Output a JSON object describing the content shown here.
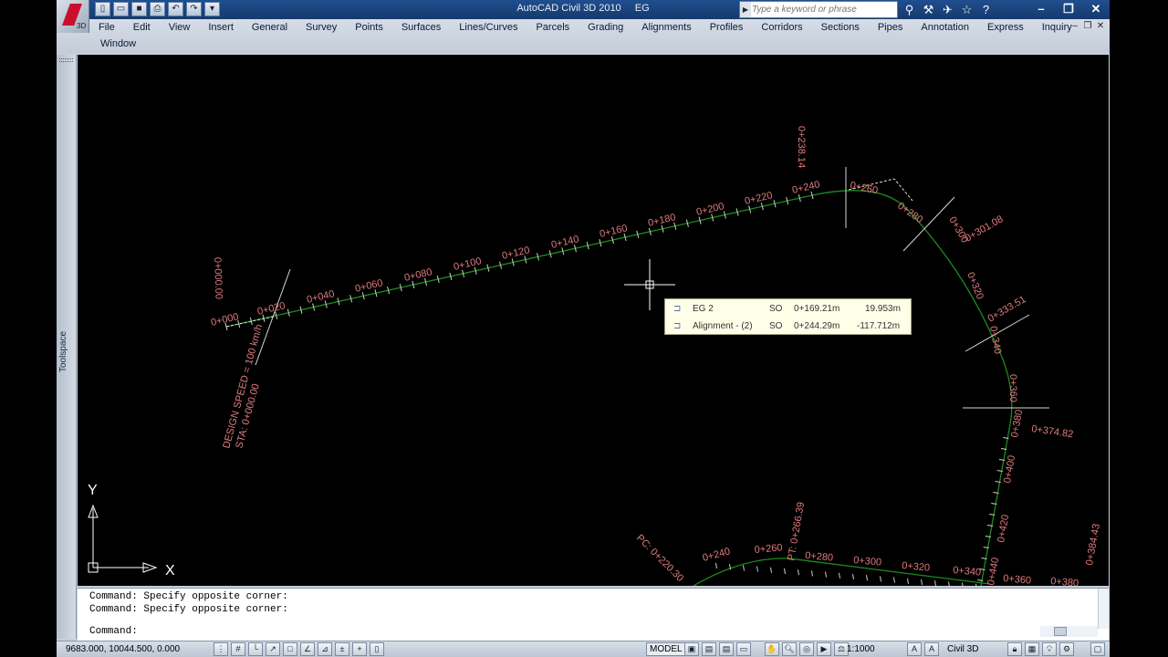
{
  "window": {
    "app_title": "AutoCAD Civil 3D 2010",
    "doc_title": "EG",
    "app_badge": "3D"
  },
  "search": {
    "placeholder": "Type a keyword or phrase"
  },
  "menu": {
    "row1": [
      "File",
      "Edit",
      "View",
      "Insert",
      "General",
      "Survey",
      "Points",
      "Surfaces",
      "Lines/Curves",
      "Parcels",
      "Grading",
      "Alignments",
      "Profiles",
      "Corridors",
      "Sections",
      "Pipes",
      "Annotation",
      "Express",
      "Inquiry"
    ],
    "row2": [
      "Window"
    ]
  },
  "toolspace": {
    "label": "Toolspace"
  },
  "drawing": {
    "ucs_y": "Y",
    "ucs_x": "X",
    "line_color": "#1c8a1c",
    "label_color": "#e07b7b",
    "alignment1_stations": [
      "0+000",
      "0+020",
      "0+040",
      "0+060",
      "0+080",
      "0+100",
      "0+120",
      "0+140",
      "0+160",
      "0+180",
      "0+200",
      "0+220",
      "0+240",
      "0+260",
      "0+280",
      "0+300",
      "0+320",
      "0+340",
      "0+360",
      "0+380",
      "0+400",
      "0+420",
      "0+440"
    ],
    "alignment1_other": [
      "0+000.00",
      "0+238.14",
      "0+301.08",
      "0+333.51",
      "0+374.82"
    ],
    "design_speed": "DESIGN SPEED = 100 km/h",
    "design_speed_sta": "STA: 0+000.00",
    "alignment2_stations": [
      "0+240",
      "0+260",
      "0+280",
      "0+300",
      "0+320",
      "0+340",
      "0+360",
      "0+380"
    ],
    "alignment2_other": [
      "PC: 0+220.30",
      "PT: 0+266.39",
      "0+384.43"
    ]
  },
  "tooltip": {
    "rows": [
      {
        "name": "EG 2",
        "code": "SO",
        "station": "0+169.21m",
        "offset": "19.953m"
      },
      {
        "name": "Alignment - (2)",
        "code": "SO",
        "station": "0+244.29m",
        "offset": "-117.712m"
      }
    ]
  },
  "command": {
    "history": [
      "Command: Specify opposite corner:",
      "Command: Specify opposite corner:"
    ],
    "prompt": "Command:"
  },
  "status": {
    "coords": "9683.000, 10044.500, 0.000",
    "model": "MODEL",
    "scale": "1:1000",
    "workspace": "Civil 3D"
  }
}
